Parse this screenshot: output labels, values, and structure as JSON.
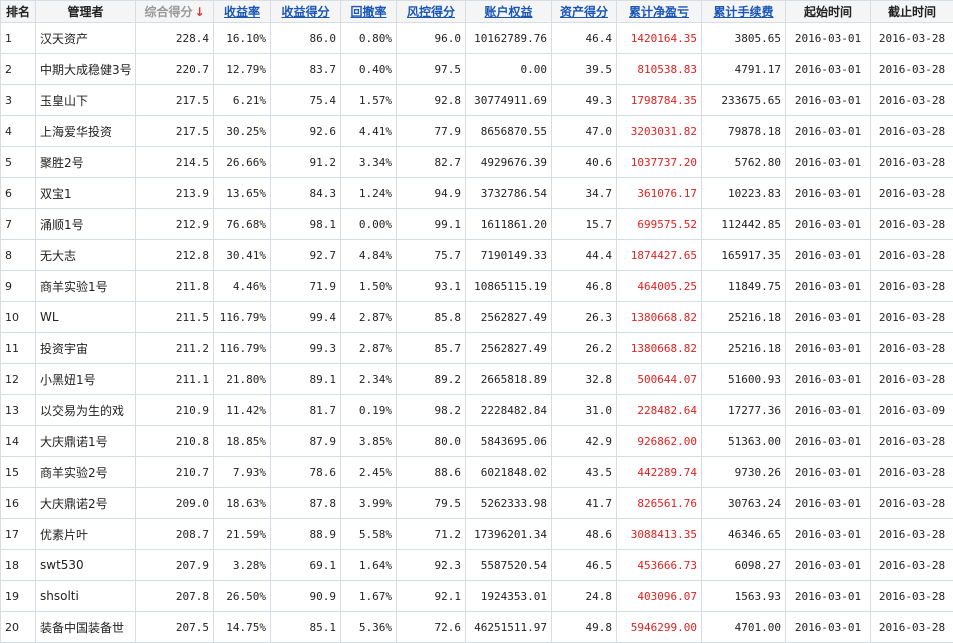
{
  "colors": {
    "header_bg": "#f5f5f5",
    "link": "#1a56b8",
    "profit": "#e02020",
    "border": "#d6dde5",
    "sorted_header": "#999999"
  },
  "headers": {
    "rank": "排名",
    "manager": "管理者",
    "composite": "综合得分",
    "sort_indicator": "↓",
    "return_rate": "收益率",
    "return_score": "收益得分",
    "drawdown": "回撤率",
    "risk_score": "风控得分",
    "equity": "账户权益",
    "asset_score": "资产得分",
    "net_pnl": "累计净盈亏",
    "fees": "累计手续费",
    "start": "起始时间",
    "end": "截止时间"
  },
  "rows": [
    [
      "1",
      "汉天资产",
      "228.4",
      "16.10%",
      "86.0",
      "0.80%",
      "96.0",
      "10162789.76",
      "46.4",
      "1420164.35",
      "3805.65",
      "2016-03-01",
      "2016-03-28"
    ],
    [
      "2",
      "中期大成稳健3号",
      "220.7",
      "12.79%",
      "83.7",
      "0.40%",
      "97.5",
      "0.00",
      "39.5",
      "810538.83",
      "4791.17",
      "2016-03-01",
      "2016-03-28"
    ],
    [
      "3",
      "玉皇山下",
      "217.5",
      "6.21%",
      "75.4",
      "1.57%",
      "92.8",
      "30774911.69",
      "49.3",
      "1798784.35",
      "233675.65",
      "2016-03-01",
      "2016-03-28"
    ],
    [
      "4",
      "上海爱华投资",
      "217.5",
      "30.25%",
      "92.6",
      "4.41%",
      "77.9",
      "8656870.55",
      "47.0",
      "3203031.82",
      "79878.18",
      "2016-03-01",
      "2016-03-28"
    ],
    [
      "5",
      "聚胜2号",
      "214.5",
      "26.66%",
      "91.2",
      "3.34%",
      "82.7",
      "4929676.39",
      "40.6",
      "1037737.20",
      "5762.80",
      "2016-03-01",
      "2016-03-28"
    ],
    [
      "6",
      "双宝1",
      "213.9",
      "13.65%",
      "84.3",
      "1.24%",
      "94.9",
      "3732786.54",
      "34.7",
      "361076.17",
      "10223.83",
      "2016-03-01",
      "2016-03-28"
    ],
    [
      "7",
      "涌顺1号",
      "212.9",
      "76.68%",
      "98.1",
      "0.00%",
      "99.1",
      "1611861.20",
      "15.7",
      "699575.52",
      "112442.85",
      "2016-03-01",
      "2016-03-28"
    ],
    [
      "8",
      "无大志",
      "212.8",
      "30.41%",
      "92.7",
      "4.84%",
      "75.7",
      "7190149.33",
      "44.4",
      "1874427.65",
      "165917.35",
      "2016-03-01",
      "2016-03-28"
    ],
    [
      "9",
      "商羊实验1号",
      "211.8",
      "4.46%",
      "71.9",
      "1.50%",
      "93.1",
      "10865115.19",
      "46.8",
      "464005.25",
      "11849.75",
      "2016-03-01",
      "2016-03-28"
    ],
    [
      "10",
      "WL",
      "211.5",
      "116.79%",
      "99.4",
      "2.87%",
      "85.8",
      "2562827.49",
      "26.3",
      "1380668.82",
      "25216.18",
      "2016-03-01",
      "2016-03-28"
    ],
    [
      "11",
      "投资宇宙",
      "211.2",
      "116.79%",
      "99.3",
      "2.87%",
      "85.7",
      "2562827.49",
      "26.2",
      "1380668.82",
      "25216.18",
      "2016-03-01",
      "2016-03-28"
    ],
    [
      "12",
      "小黑妞1号",
      "211.1",
      "21.80%",
      "89.1",
      "2.34%",
      "89.2",
      "2665818.89",
      "32.8",
      "500644.07",
      "51600.93",
      "2016-03-01",
      "2016-03-28"
    ],
    [
      "13",
      "以交易为生的戏",
      "210.9",
      "11.42%",
      "81.7",
      "0.19%",
      "98.2",
      "2228482.84",
      "31.0",
      "228482.64",
      "17277.36",
      "2016-03-01",
      "2016-03-09"
    ],
    [
      "14",
      "大庆鼎诺1号",
      "210.8",
      "18.85%",
      "87.9",
      "3.85%",
      "80.0",
      "5843695.06",
      "42.9",
      "926862.00",
      "51363.00",
      "2016-03-01",
      "2016-03-28"
    ],
    [
      "15",
      "商羊实验2号",
      "210.7",
      "7.93%",
      "78.6",
      "2.45%",
      "88.6",
      "6021848.02",
      "43.5",
      "442289.74",
      "9730.26",
      "2016-03-01",
      "2016-03-28"
    ],
    [
      "16",
      "大庆鼎诺2号",
      "209.0",
      "18.63%",
      "87.8",
      "3.99%",
      "79.5",
      "5262333.98",
      "41.7",
      "826561.76",
      "30763.24",
      "2016-03-01",
      "2016-03-28"
    ],
    [
      "17",
      "优素片叶",
      "208.7",
      "21.59%",
      "88.9",
      "5.58%",
      "71.2",
      "17396201.34",
      "48.6",
      "3088413.35",
      "46346.65",
      "2016-03-01",
      "2016-03-28"
    ],
    [
      "18",
      "swt530",
      "207.9",
      "3.28%",
      "69.1",
      "1.64%",
      "92.3",
      "5587520.54",
      "46.5",
      "453666.73",
      "6098.27",
      "2016-03-01",
      "2016-03-28"
    ],
    [
      "19",
      "shsolti",
      "207.8",
      "26.50%",
      "90.9",
      "1.67%",
      "92.1",
      "1924353.01",
      "24.8",
      "403096.07",
      "1563.93",
      "2016-03-01",
      "2016-03-28"
    ],
    [
      "20",
      "装备中国装备世",
      "207.5",
      "14.75%",
      "85.1",
      "5.36%",
      "72.6",
      "46251511.97",
      "49.8",
      "5946299.00",
      "4701.00",
      "2016-03-01",
      "2016-03-28"
    ]
  ]
}
